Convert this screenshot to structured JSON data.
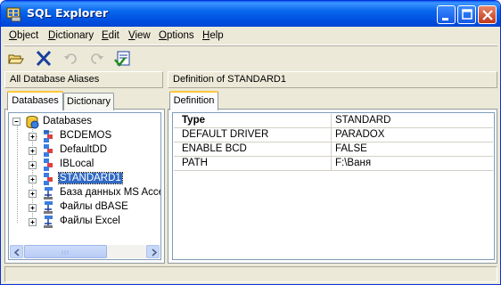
{
  "window": {
    "title": "SQL Explorer",
    "colors": {
      "titlebar": "#0050e0",
      "selection": "#316ac5",
      "close_button": "#c1391a",
      "tab_highlight": "#ffc83c"
    }
  },
  "menu": [
    {
      "pre": "",
      "u": "O",
      "post": "bject"
    },
    {
      "pre": "",
      "u": "D",
      "post": "ictionary"
    },
    {
      "pre": "",
      "u": "E",
      "post": "dit"
    },
    {
      "pre": "",
      "u": "V",
      "post": "iew"
    },
    {
      "pre": "",
      "u": "O",
      "post": "ptions"
    },
    {
      "pre": "",
      "u": "H",
      "post": "elp"
    }
  ],
  "toolbar": {
    "icons": [
      "open-folder-icon",
      "delete-x-icon",
      "undo-icon",
      "redo-icon",
      "apply-icon"
    ]
  },
  "left_pane": {
    "header": "All Database Aliases",
    "tabs": [
      "Databases",
      "Dictionary"
    ],
    "active_tab": "Databases",
    "tree": {
      "root": "Databases",
      "items": [
        {
          "label": "BCDEMOS",
          "icon": "database-alias-icon",
          "selected": false
        },
        {
          "label": "DefaultDD",
          "icon": "database-alias-icon",
          "selected": false
        },
        {
          "label": "IBLocal",
          "icon": "database-alias-icon",
          "selected": false
        },
        {
          "label": "STANDARD1",
          "icon": "database-alias-icon",
          "selected": true
        },
        {
          "label": "База данных MS Acce",
          "icon": "odbc-alias-icon",
          "selected": false
        },
        {
          "label": "Файлы dBASE",
          "icon": "odbc-alias-icon",
          "selected": false
        },
        {
          "label": "Файлы Excel",
          "icon": "odbc-alias-icon",
          "selected": false
        }
      ]
    }
  },
  "right_pane": {
    "header": "Definition of STANDARD1",
    "tabs": [
      "Definition"
    ],
    "active_tab": "Definition",
    "definition": {
      "head": {
        "key": "Type",
        "value": "STANDARD"
      },
      "rows": [
        {
          "key": "DEFAULT DRIVER",
          "value": "PARADOX"
        },
        {
          "key": "ENABLE BCD",
          "value": "FALSE"
        },
        {
          "key": "PATH",
          "value": "F:\\Ваня"
        }
      ]
    }
  },
  "status": ""
}
